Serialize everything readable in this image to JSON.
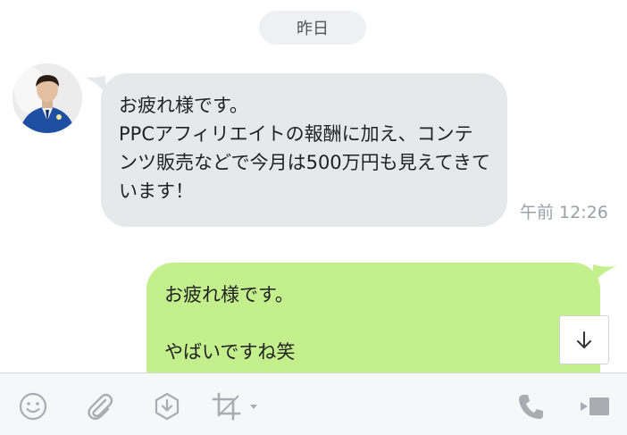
{
  "date_separator": "昨日",
  "messages": [
    {
      "direction": "incoming",
      "text": "お疲れ様です。\nPPCアフィリエイトの報酬に加え、コンテンツ販売などで今月は500万円も見えてきています！",
      "time": "午前 12:26"
    },
    {
      "direction": "outgoing",
      "text": "お疲れ様です。\n\nやばいですね笑"
    }
  ],
  "toolbar": {
    "left_icons": [
      "emoji-icon",
      "paperclip-icon",
      "download-icon",
      "crop-icon"
    ],
    "right_icons": [
      "phone-icon",
      "video-icon"
    ]
  },
  "colors": {
    "incoming_bubble": "#e6e8ea",
    "outgoing_bubble": "#c3ef8c",
    "toolbar_bg": "#f6f7f8",
    "icon_gray": "#a9adb2"
  }
}
